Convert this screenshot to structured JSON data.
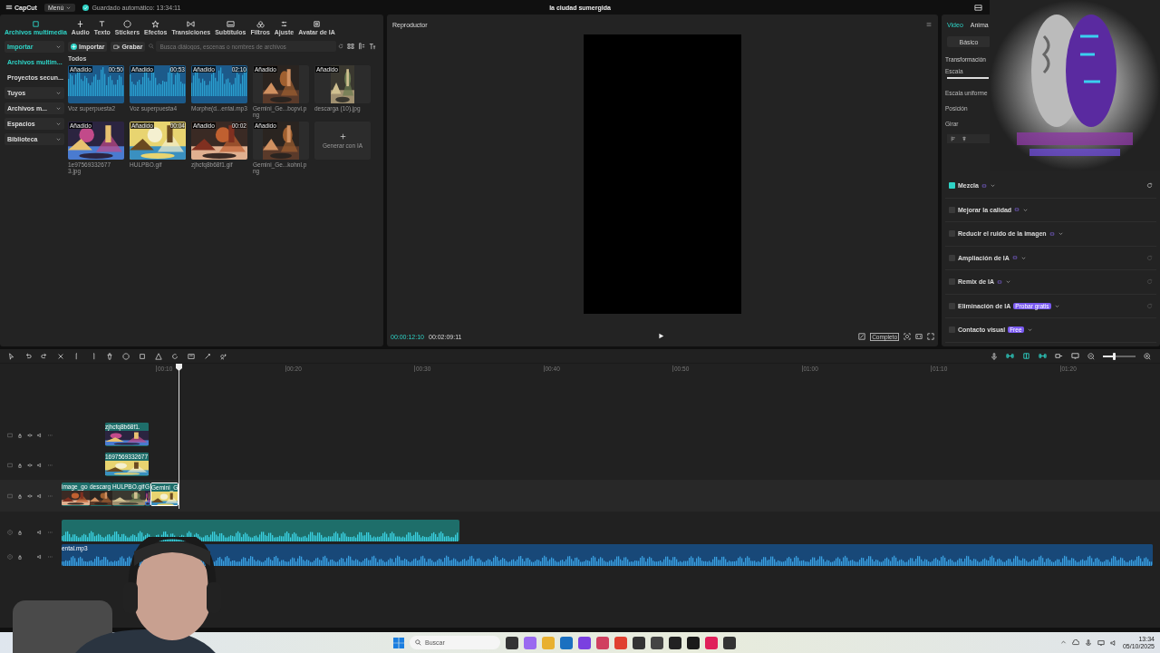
{
  "app": {
    "logo": "CapCut",
    "menu": "Menú",
    "autosave": "Guardado automático: 13:34:11",
    "title": "la ciudad sumergida"
  },
  "toolbar": [
    {
      "label": "Archivos multimedia",
      "selected": true
    },
    {
      "label": "Audio",
      "selected": false
    },
    {
      "label": "Texto",
      "selected": false
    },
    {
      "label": "Stickers",
      "selected": false
    },
    {
      "label": "Efectos",
      "selected": false
    },
    {
      "label": "Transiciones",
      "selected": false
    },
    {
      "label": "Subtítulos",
      "selected": false
    },
    {
      "label": "Filtros",
      "selected": false
    },
    {
      "label": "Ajuste",
      "selected": false
    },
    {
      "label": "Avatar de IA",
      "selected": false
    }
  ],
  "sidebar": [
    {
      "kind": "group",
      "label": "Importar",
      "selected": true
    },
    {
      "kind": "link",
      "label": "Archivos multim...",
      "selected": true
    },
    {
      "kind": "link",
      "label": "Proyectos secun...",
      "selected": false
    },
    {
      "kind": "group",
      "label": "Tuyos",
      "selected": false
    },
    {
      "kind": "group",
      "label": "Archivos m...",
      "selected": false
    },
    {
      "kind": "group",
      "label": "Espacios",
      "selected": false
    },
    {
      "kind": "group",
      "label": "Biblioteca",
      "selected": false
    }
  ],
  "media_bar": {
    "import": "Importar",
    "record": "Grabar",
    "placeholder": "Busca diálogos, escenas o nombres de archivos"
  },
  "media_section": "Todos",
  "media": [
    {
      "kind": "audio",
      "badge": "Añadido",
      "duration": "00:50",
      "name": "Voz superpuesta2"
    },
    {
      "kind": "audio",
      "badge": "Añadido",
      "duration": "00:53",
      "name": "Voz superpuesta4"
    },
    {
      "kind": "audio",
      "badge": "Añadido",
      "duration": "02:10",
      "name": "Morphe(d...ental.mp3"
    },
    {
      "kind": "picture",
      "badge": "Añadido",
      "name": "Gemini_Ge...bopvi.png"
    },
    {
      "kind": "picture",
      "badge": "Añadido",
      "name": "descarga (10).jpg"
    },
    {
      "kind": "picture",
      "badge": "Añadido",
      "name": "1e97569332677 3.jpg"
    },
    {
      "kind": "picture",
      "badge": "Añadido",
      "duration": "00:04",
      "name": "HULPBO.gif"
    },
    {
      "kind": "picture",
      "badge": "Añadido",
      "duration": "00:02",
      "name": "zjhcfq8b68f1.gif"
    },
    {
      "kind": "picture",
      "badge": "Añadido",
      "name": "Gemini_Ge...kohnl.png"
    },
    {
      "kind": "generate",
      "name": "Generar con IA"
    }
  ],
  "player": {
    "title": "Reproductor",
    "current": "00:00:12:10",
    "total": "00:02:09:11",
    "ratio": "Completo"
  },
  "inspector": {
    "tabs": [
      {
        "label": "Video",
        "selected": true
      },
      {
        "label": "Anima",
        "selected": false
      }
    ],
    "mode": "Básico",
    "section": "Transformación",
    "fields": [
      "Escala",
      "Escala uniforme",
      "Posición",
      "Girar"
    ],
    "options": [
      {
        "label": "Mezcla",
        "checked": true
      },
      {
        "label": "Mejorar la calidad",
        "checked": false
      },
      {
        "label": "Reducir el ruido de la imagen",
        "checked": false
      },
      {
        "label": "Ampliación de IA",
        "checked": false
      },
      {
        "label": "Remix de IA",
        "checked": false
      },
      {
        "label": "Eliminación de IA",
        "checked": false,
        "badge": "Probar gratis"
      },
      {
        "label": "Contacto visual",
        "checked": false,
        "badge": "Free"
      }
    ]
  },
  "timeline": {
    "zoom": {
      "level": 0.3
    },
    "ticks": [
      "00:10",
      "00:20",
      "00:30",
      "00:40",
      "00:50",
      "01:00",
      "01:10",
      "01:20"
    ],
    "tracks": [
      {
        "kind": "video",
        "clips": [
          {
            "label": "zjhcfq8b68f1.",
            "selected": false
          }
        ]
      },
      {
        "kind": "video",
        "clips": [
          {
            "label": "1697569332677",
            "selected": false
          }
        ]
      },
      {
        "kind": "main",
        "clips": [
          {
            "label": "image_go",
            "selected": false
          },
          {
            "label": "descarg",
            "selected": false
          },
          {
            "label": "HULPBO.gif",
            "selected": false
          },
          {
            "label": "G",
            "selected": false
          },
          {
            "label": "Gemini_G",
            "selected": true
          }
        ]
      },
      {
        "kind": "audio",
        "clips": [
          {
            "selected": false
          }
        ]
      },
      {
        "kind": "music",
        "clips": [
          {
            "label": "ental.mp3",
            "selected": false
          }
        ]
      }
    ]
  },
  "taskbar": {
    "search": "Buscar",
    "time": "13:34",
    "date": "05/10/2025"
  }
}
